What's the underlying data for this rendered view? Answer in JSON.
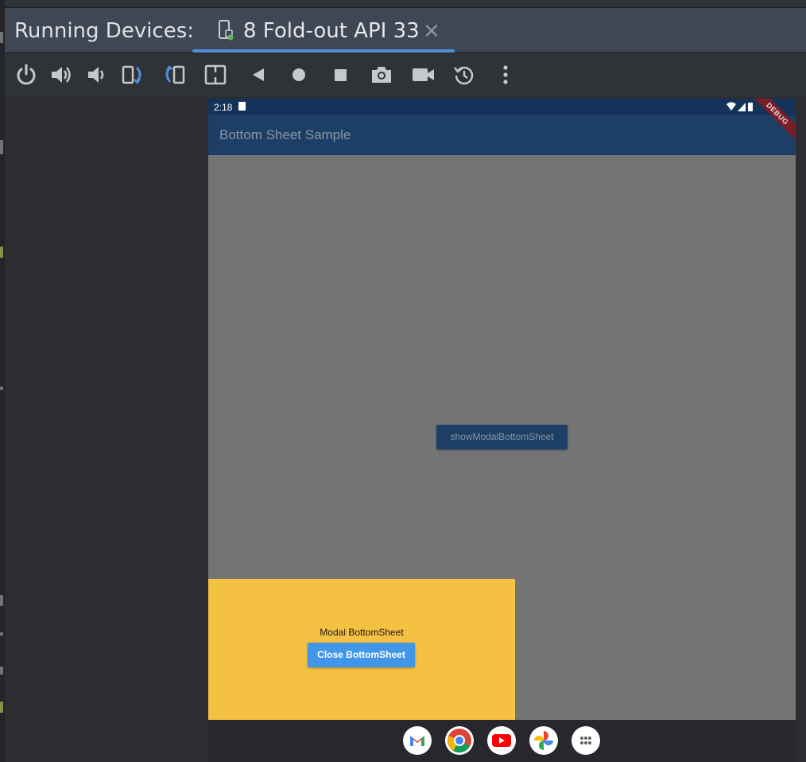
{
  "tool_window": {
    "title": "Running Devices:",
    "tab": {
      "label": "8 Fold-out API 33",
      "close_glyph": "✕",
      "icon": "device-phone-icon"
    }
  },
  "toolbar": {
    "buttons": [
      {
        "name": "power-icon"
      },
      {
        "name": "volume-up-icon"
      },
      {
        "name": "volume-down-icon"
      },
      {
        "name": "rotate-left-icon"
      },
      {
        "name": "rotate-right-icon"
      },
      {
        "name": "fold-icon"
      },
      {
        "name": "back-icon"
      },
      {
        "name": "home-icon"
      },
      {
        "name": "overview-icon"
      },
      {
        "name": "screenshot-icon"
      },
      {
        "name": "screen-record-icon"
      },
      {
        "name": "reset-icon"
      },
      {
        "name": "more-options-icon"
      }
    ]
  },
  "device": {
    "status_bar": {
      "time": "2:18"
    },
    "app_bar": {
      "title": "Bottom Sheet Sample"
    },
    "debug_banner": "DEBUG",
    "show_button": "showModalBottomSheet",
    "bottom_sheet": {
      "message": "Modal BottomSheet",
      "close_button": "Close BottomSheet"
    },
    "dock_apps": [
      "gmail-icon",
      "chrome-icon",
      "youtube-icon",
      "photos-icon",
      "app-drawer-icon"
    ]
  },
  "colors": {
    "tab_bar": "#3f4754",
    "tab_underline": "#4f8fd8",
    "app_bar": "#1d3f66",
    "scrim": "#747474",
    "sheet": "#f4c142",
    "close_button": "#4196e8"
  }
}
